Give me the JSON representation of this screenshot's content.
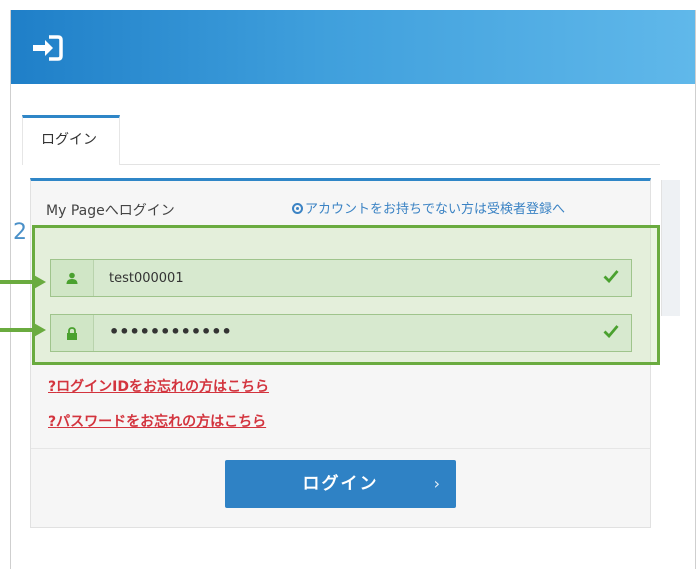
{
  "header": {
    "icon": "sign-in-icon"
  },
  "tabs": [
    {
      "label": "ログイン",
      "active": true
    }
  ],
  "panel": {
    "title": "My Pageへログイン",
    "register_link": "アカウントをお持ちでない方は受検者登録へ"
  },
  "annotation": {
    "step": "2"
  },
  "form": {
    "login_id": {
      "value": "test000001",
      "icon": "user-icon",
      "status": "check-icon"
    },
    "password": {
      "value": "••••••••••••",
      "icon": "lock-icon",
      "status": "check-icon"
    }
  },
  "links": {
    "forgot_id_mark": "?",
    "forgot_id": "ログインIDをお忘れの方はこちら",
    "forgot_password_mark": "?",
    "forgot_password": "パスワードをお忘れの方はこちら"
  },
  "login_button": {
    "label": "ログイン",
    "chevron": "›"
  },
  "colors": {
    "header": "#2f8fd6",
    "accent": "#2f86c7",
    "highlight": "#6aab3f",
    "link_red": "#d3343e",
    "valid_green": "#4aa12f"
  }
}
